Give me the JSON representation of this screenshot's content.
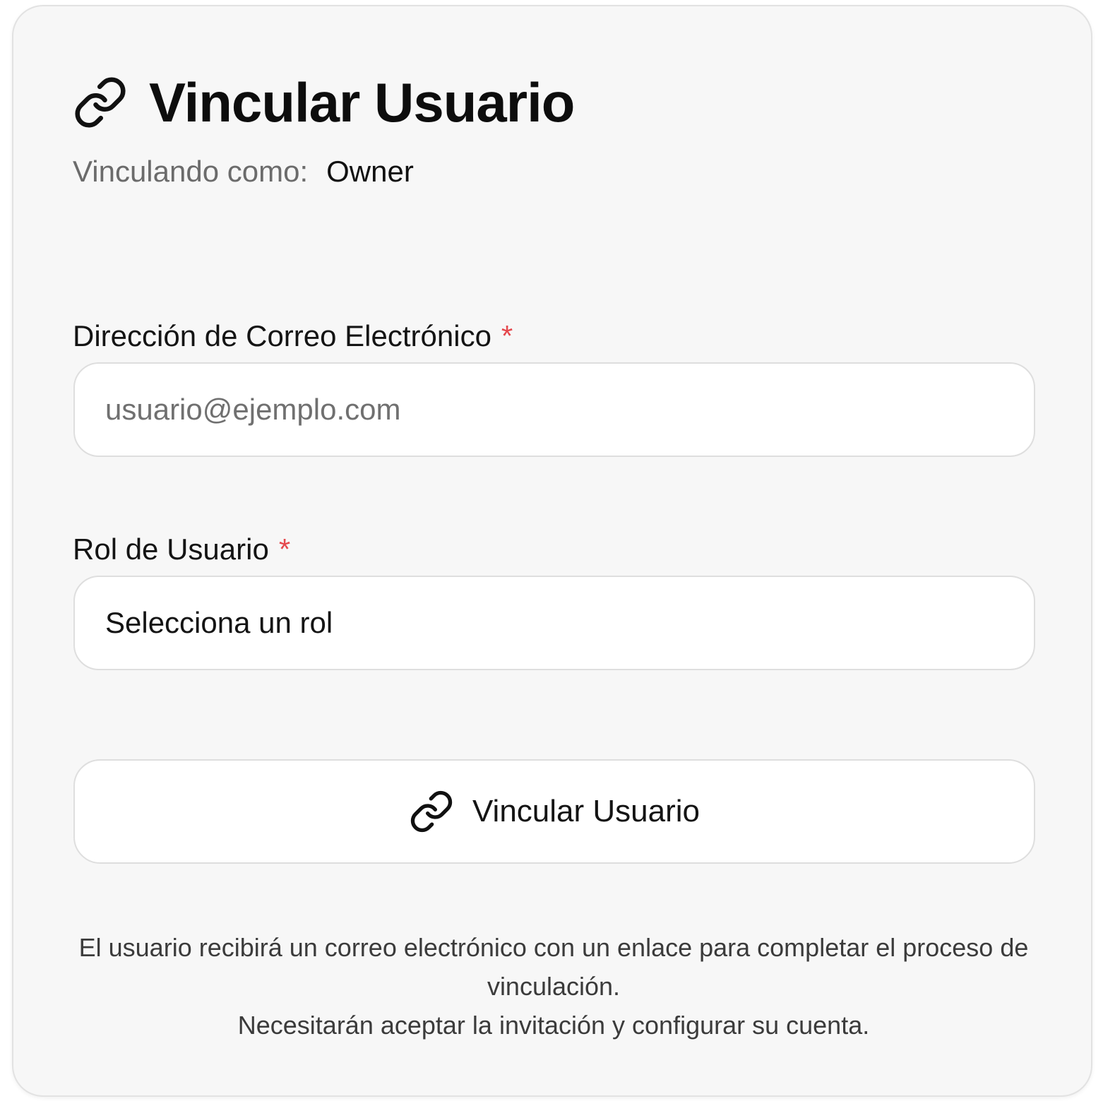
{
  "header": {
    "icon": "link-icon",
    "title": "Vincular Usuario",
    "subtitle_label": "Vinculando como:",
    "subtitle_value": "Owner"
  },
  "form": {
    "email": {
      "label": "Dirección de Correo Electrónico",
      "required_mark": "*",
      "placeholder": "usuario@ejemplo.com",
      "value": ""
    },
    "role": {
      "label": "Rol de Usuario",
      "required_mark": "*",
      "selected": "Selecciona un rol"
    },
    "submit": {
      "icon": "link-icon",
      "label": "Vincular Usuario"
    }
  },
  "note": {
    "line1": "El usuario recibirá un correo electrónico con un enlace para completar el proceso de vinculación.",
    "line2": "Necesitarán aceptar la invitación y configurar su cuenta."
  },
  "colors": {
    "card_background": "#f7f7f7",
    "required": "#e5484d",
    "muted_text": "#6b6b6b"
  }
}
